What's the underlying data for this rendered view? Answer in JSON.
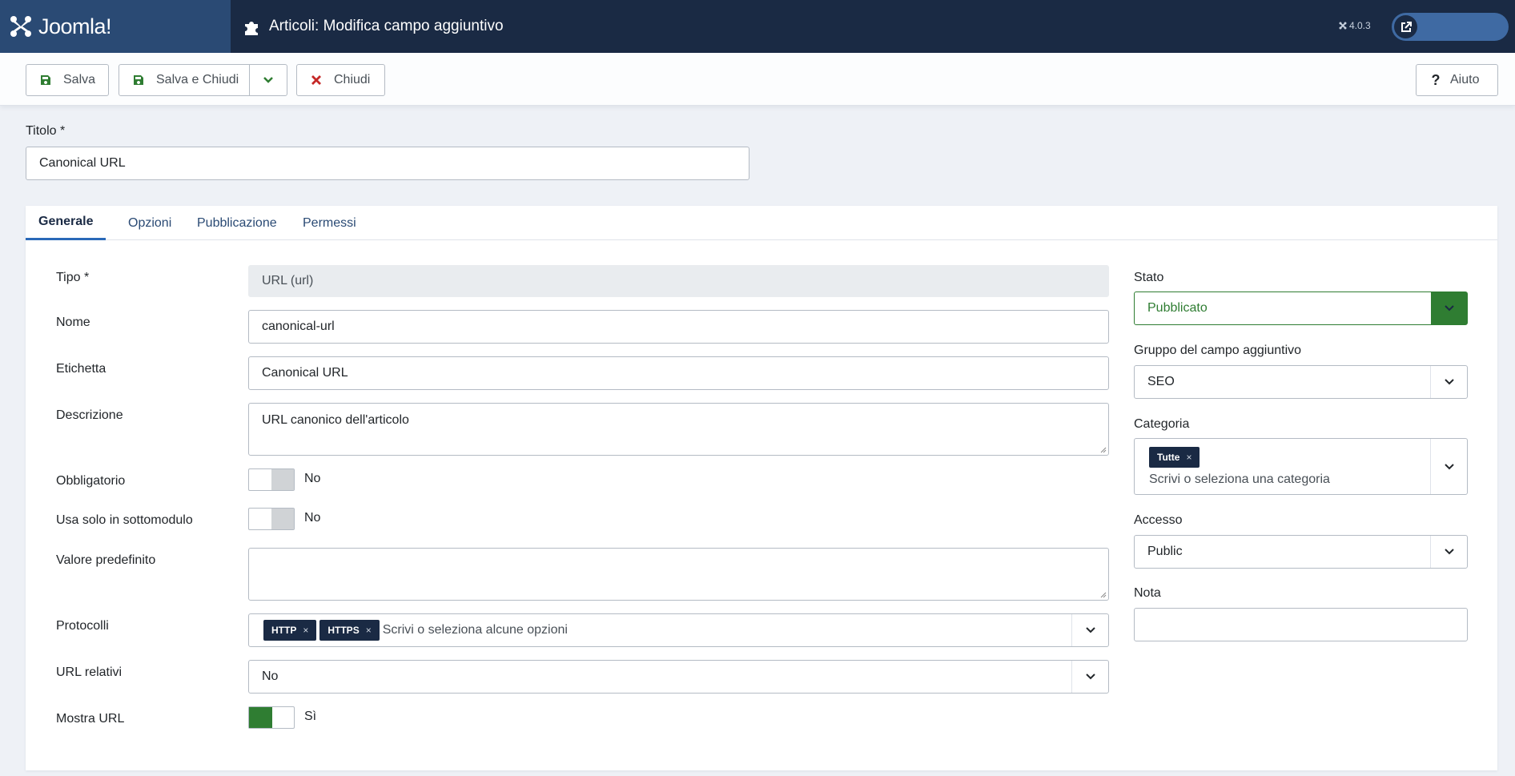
{
  "header": {
    "logo": "Joomla!",
    "page_title": "Articoli: Modifica campo aggiuntivo",
    "version": "4.0.3"
  },
  "toolbar": {
    "save_label": "Salva",
    "save_close_label": "Salva e Chiudi",
    "close_label": "Chiudi",
    "help_label": "Aiuto"
  },
  "title_field": {
    "label": "Titolo *",
    "value": "Canonical URL"
  },
  "tabs": [
    {
      "label": "Generale",
      "active": true
    },
    {
      "label": "Opzioni",
      "active": false
    },
    {
      "label": "Pubblicazione",
      "active": false
    },
    {
      "label": "Permessi",
      "active": false
    }
  ],
  "main_fields": {
    "type": {
      "label": "Tipo *",
      "value": "URL (url)"
    },
    "name": {
      "label": "Nome",
      "value": "canonical-url"
    },
    "label": {
      "label": "Etichetta",
      "value": "Canonical URL"
    },
    "description": {
      "label": "Descrizione",
      "value": "URL canonico dell'articolo"
    },
    "required": {
      "label": "Obbligatorio",
      "value": "No"
    },
    "only_use_in_subform": {
      "label": "Usa solo in sottomodulo",
      "value": "No"
    },
    "default_value": {
      "label": "Valore predefinito",
      "value": ""
    },
    "protocols": {
      "label": "Protocolli",
      "chips": [
        "HTTP",
        "HTTPS"
      ],
      "placeholder": "Scrivi o seleziona alcune opzioni"
    },
    "relative_urls": {
      "label": "URL relativi",
      "value": "No"
    },
    "show_url": {
      "label": "Mostra URL",
      "value": "Sì"
    }
  },
  "side_fields": {
    "state": {
      "label": "Stato",
      "value": "Pubblicato"
    },
    "field_group": {
      "label": "Gruppo del campo aggiuntivo",
      "value": "SEO"
    },
    "category": {
      "label": "Categoria",
      "chips": [
        "Tutte"
      ],
      "placeholder": "Scrivi o seleziona una categoria"
    },
    "access": {
      "label": "Accesso",
      "value": "Public"
    },
    "note": {
      "label": "Nota",
      "value": ""
    }
  },
  "colors": {
    "header_bg": "#1a2a44",
    "logo_bg": "#2a4a74",
    "success": "#2f7d32",
    "danger": "#c52827",
    "chip_bg": "#1a2a44"
  },
  "icons": [
    "joomla-logo-icon",
    "puzzle-icon",
    "external-link-icon",
    "save-icon",
    "chevron-down-icon",
    "close-icon",
    "question-icon"
  ]
}
